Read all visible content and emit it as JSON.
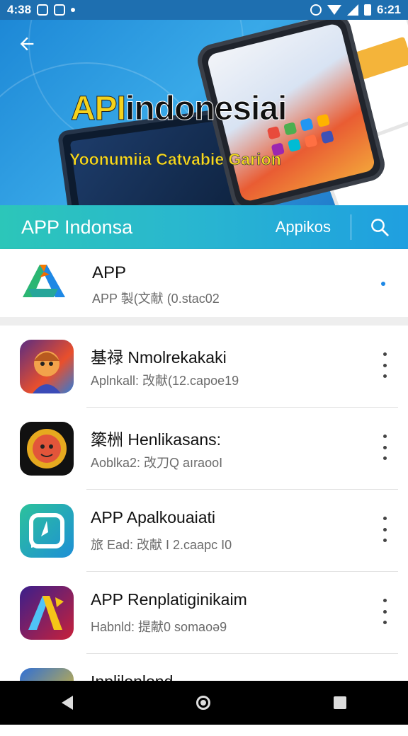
{
  "status_bar": {
    "time": "4:38",
    "right_text": "6:21"
  },
  "banner": {
    "title_highlight": "API",
    "title_rest": "indonesiai",
    "subtitle": "Yoonumiia Catvabie Garion"
  },
  "appbar": {
    "title": "APP Indonsa",
    "tab": "Appikos"
  },
  "featured": {
    "title": "APP",
    "subtitle": "APP 製(文献 (0.stac02"
  },
  "apps": [
    {
      "title": "基禄 Nmolrekakaki",
      "subtitle": "Aplnkall: 改献(12.capoe19",
      "icon": "game-hero-icon"
    },
    {
      "title": "簗栦 Henlikasans:",
      "subtitle": "Aoblka2: 改刀Q aıraooI",
      "icon": "lion-emblem-icon"
    },
    {
      "title": "APP Apalkouaiati",
      "subtitle": "旅 Ead: 改献 I 2.caapc I0",
      "icon": "chat-bubble-icon"
    },
    {
      "title": "APP Renplatiginikaim",
      "subtitle": "Habnld: 提献0 somaoə9",
      "icon": "a-letter-icon"
    },
    {
      "title": "Inplilonlond",
      "subtitle": "",
      "icon": "star-icon"
    }
  ]
}
